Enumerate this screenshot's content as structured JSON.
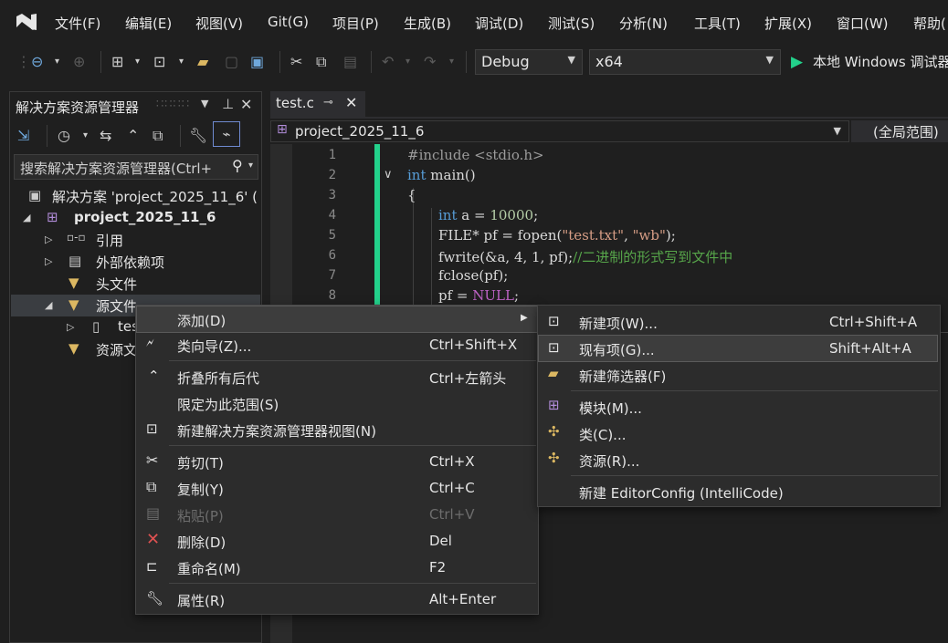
{
  "menubar": {
    "items": [
      "文件(F)",
      "编辑(E)",
      "视图(V)",
      "Git(G)",
      "项目(P)",
      "生成(B)",
      "调试(D)",
      "测试(S)",
      "分析(N)",
      "工具(T)",
      "扩展(X)",
      "窗口(W)",
      "帮助("
    ]
  },
  "toolbar": {
    "config": "Debug",
    "platform": "x64",
    "run_label": "本地 Windows 调试器"
  },
  "solution_explorer": {
    "title": "解决方案资源管理器",
    "search_placeholder": "搜索解决方案资源管理器(Ctrl+",
    "solution": "解决方案 'project_2025_11_6' (",
    "project": "project_2025_11_6",
    "nodes": [
      "引用",
      "外部依赖项",
      "头文件",
      "源文件",
      "tes",
      "资源文"
    ]
  },
  "editor": {
    "tab": "test.c",
    "nav_project": "project_2025_11_6",
    "nav_scope": "(全局范围)",
    "line_numbers": [
      "1",
      "2",
      "3",
      "4",
      "5",
      "6",
      "7",
      "8"
    ]
  },
  "context_menu": {
    "items": [
      {
        "label": "添加(D)",
        "shortcut": "",
        "icon": "",
        "submenu": true
      },
      {
        "label": "类向导(Z)...",
        "shortcut": "Ctrl+Shift+X",
        "icon": "class-wizard-icon"
      },
      {
        "label": "折叠所有后代",
        "shortcut": "Ctrl+左箭头",
        "icon": "collapse-icon"
      },
      {
        "label": "限定为此范围(S)",
        "shortcut": "",
        "icon": ""
      },
      {
        "label": "新建解决方案资源管理器视图(N)",
        "shortcut": "",
        "icon": "new-view-icon"
      },
      {
        "label": "剪切(T)",
        "shortcut": "Ctrl+X",
        "icon": "cut-icon"
      },
      {
        "label": "复制(Y)",
        "shortcut": "Ctrl+C",
        "icon": "copy-icon"
      },
      {
        "label": "粘贴(P)",
        "shortcut": "Ctrl+V",
        "icon": "paste-icon",
        "disabled": true
      },
      {
        "label": "删除(D)",
        "shortcut": "Del",
        "icon": "delete-icon"
      },
      {
        "label": "重命名(M)",
        "shortcut": "F2",
        "icon": "rename-icon"
      },
      {
        "label": "属性(R)",
        "shortcut": "Alt+Enter",
        "icon": "wrench-icon"
      }
    ]
  },
  "submenu": {
    "items": [
      {
        "label": "新建项(W)...",
        "shortcut": "Ctrl+Shift+A",
        "icon": "new-item-icon"
      },
      {
        "label": "现有项(G)...",
        "shortcut": "Shift+Alt+A",
        "icon": "existing-item-icon",
        "highlighted": true
      },
      {
        "label": "新建筛选器(F)",
        "shortcut": "",
        "icon": "new-filter-icon"
      },
      {
        "label": "模块(M)...",
        "shortcut": "",
        "icon": "module-icon"
      },
      {
        "label": "类(C)...",
        "shortcut": "",
        "icon": "class-icon"
      },
      {
        "label": "资源(R)...",
        "shortcut": "",
        "icon": "resource-icon"
      },
      {
        "label": "新建 EditorConfig (IntelliCode)",
        "shortcut": "",
        "icon": ""
      }
    ]
  },
  "colors": {
    "background": "#1f1f1f",
    "accent_green": "#23d18b",
    "keyword_blue": "#569cd6",
    "string_brown": "#d69d85",
    "comment_green": "#57a64a",
    "delete_red": "#e05252"
  }
}
